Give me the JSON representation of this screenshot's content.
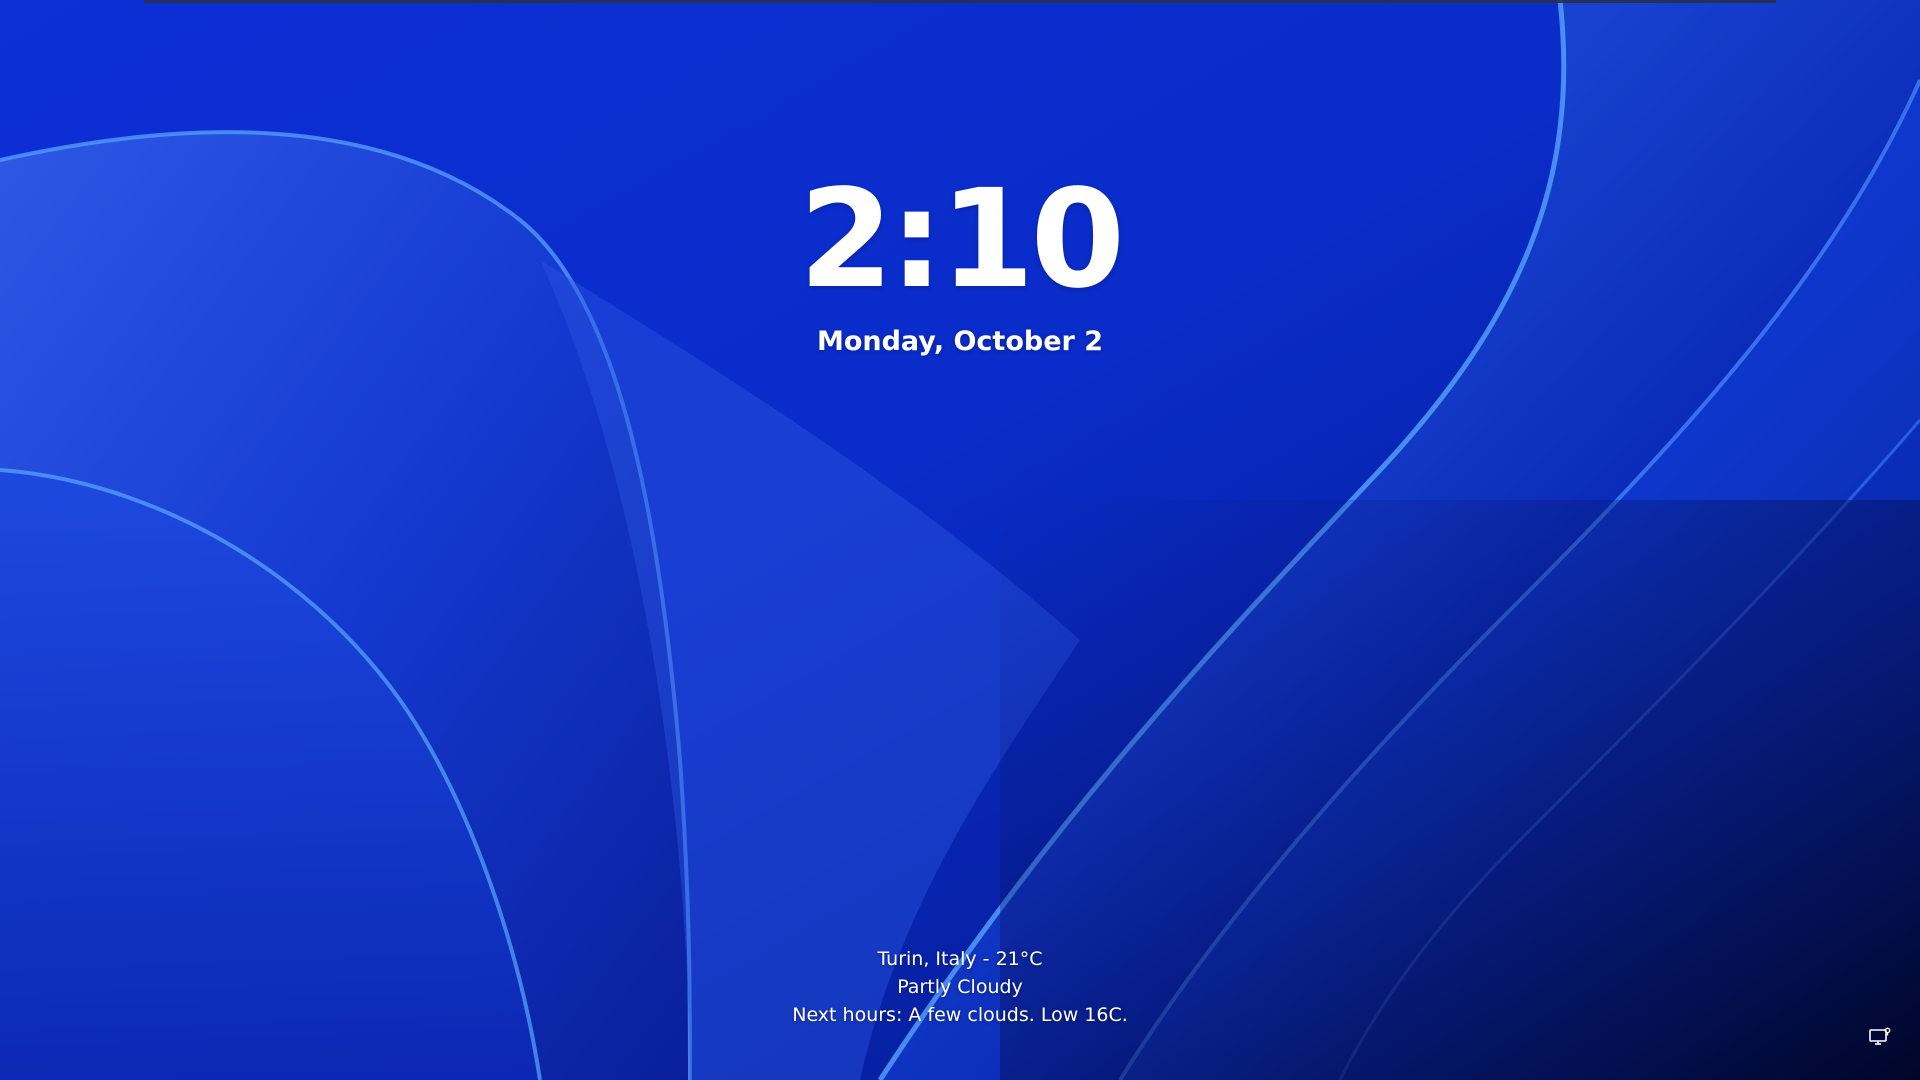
{
  "clock": {
    "time": "2:10",
    "date": "Monday, October 2"
  },
  "weather": {
    "location_temp": "Turin, Italy - 21°C",
    "condition": "Partly Cloudy",
    "forecast": "Next hours: A few clouds. Low 16C."
  },
  "status_icons": [
    "network-icon"
  ],
  "colors": {
    "background": "#0a2cc8",
    "text": "#ffffff"
  }
}
